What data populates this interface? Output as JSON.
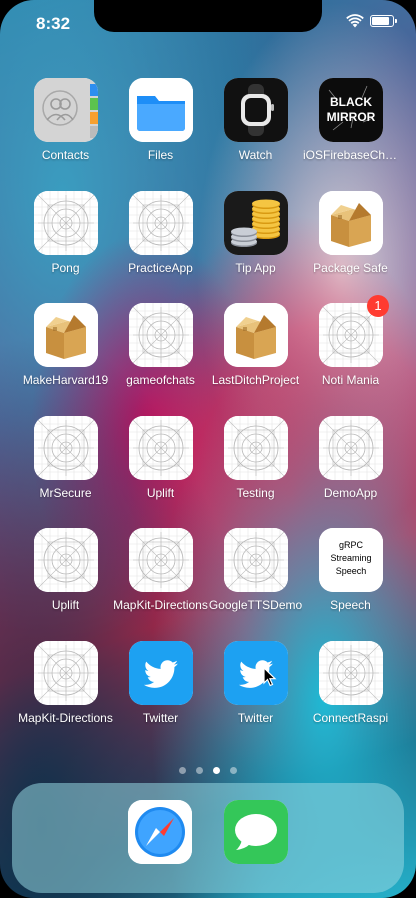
{
  "status_bar": {
    "time": "8:32",
    "battery_level": 0.9
  },
  "apps": [
    {
      "label": "Contacts",
      "icon": "contacts-icon"
    },
    {
      "label": "Files",
      "icon": "files-icon"
    },
    {
      "label": "Watch",
      "icon": "watch-icon"
    },
    {
      "label": "iOSFirebaseCha...",
      "icon": "black-mirror-icon",
      "icon_text": [
        "BLACK",
        "MIRROR"
      ]
    },
    {
      "label": "Pong",
      "icon": "blank-app-icon"
    },
    {
      "label": "PracticeApp",
      "icon": "blank-app-icon"
    },
    {
      "label": "Tip App",
      "icon": "coins-icon"
    },
    {
      "label": "Package Safe",
      "icon": "package-icon"
    },
    {
      "label": "MakeHarvard19",
      "icon": "package-icon"
    },
    {
      "label": "gameofchats",
      "icon": "blank-app-icon"
    },
    {
      "label": "LastDitchProject",
      "icon": "package-icon"
    },
    {
      "label": "Noti Mania",
      "icon": "blank-app-icon",
      "badge": "1"
    },
    {
      "label": "MrSecure",
      "icon": "blank-app-icon"
    },
    {
      "label": "Uplift",
      "icon": "blank-app-icon"
    },
    {
      "label": "Testing",
      "icon": "blank-app-icon"
    },
    {
      "label": "DemoApp",
      "icon": "blank-app-icon"
    },
    {
      "label": "Uplift",
      "icon": "blank-app-icon"
    },
    {
      "label": "MapKit-Directions",
      "icon": "blank-app-icon"
    },
    {
      "label": "GoogleTTSDemo",
      "icon": "blank-app-icon"
    },
    {
      "label": "Speech",
      "icon": "grpc-icon",
      "icon_text": [
        "gRPC",
        "Streaming",
        "Speech"
      ]
    },
    {
      "label": "MapKit-Directions",
      "icon": "blank-app-icon"
    },
    {
      "label": "Twitter",
      "icon": "twitter-icon"
    },
    {
      "label": "Twitter",
      "icon": "twitter-icon"
    },
    {
      "label": "ConnectRaspi",
      "icon": "blank-app-icon"
    }
  ],
  "page_indicator": {
    "count": 4,
    "current": 3
  },
  "dock": [
    {
      "name": "Safari",
      "icon": "safari-icon"
    },
    {
      "name": "Messages",
      "icon": "messages-icon"
    }
  ],
  "colors": {
    "badge": "#ff3b30",
    "twitter": "#1da1f2",
    "files": "#1e8ef7",
    "messages": "#34c759"
  }
}
